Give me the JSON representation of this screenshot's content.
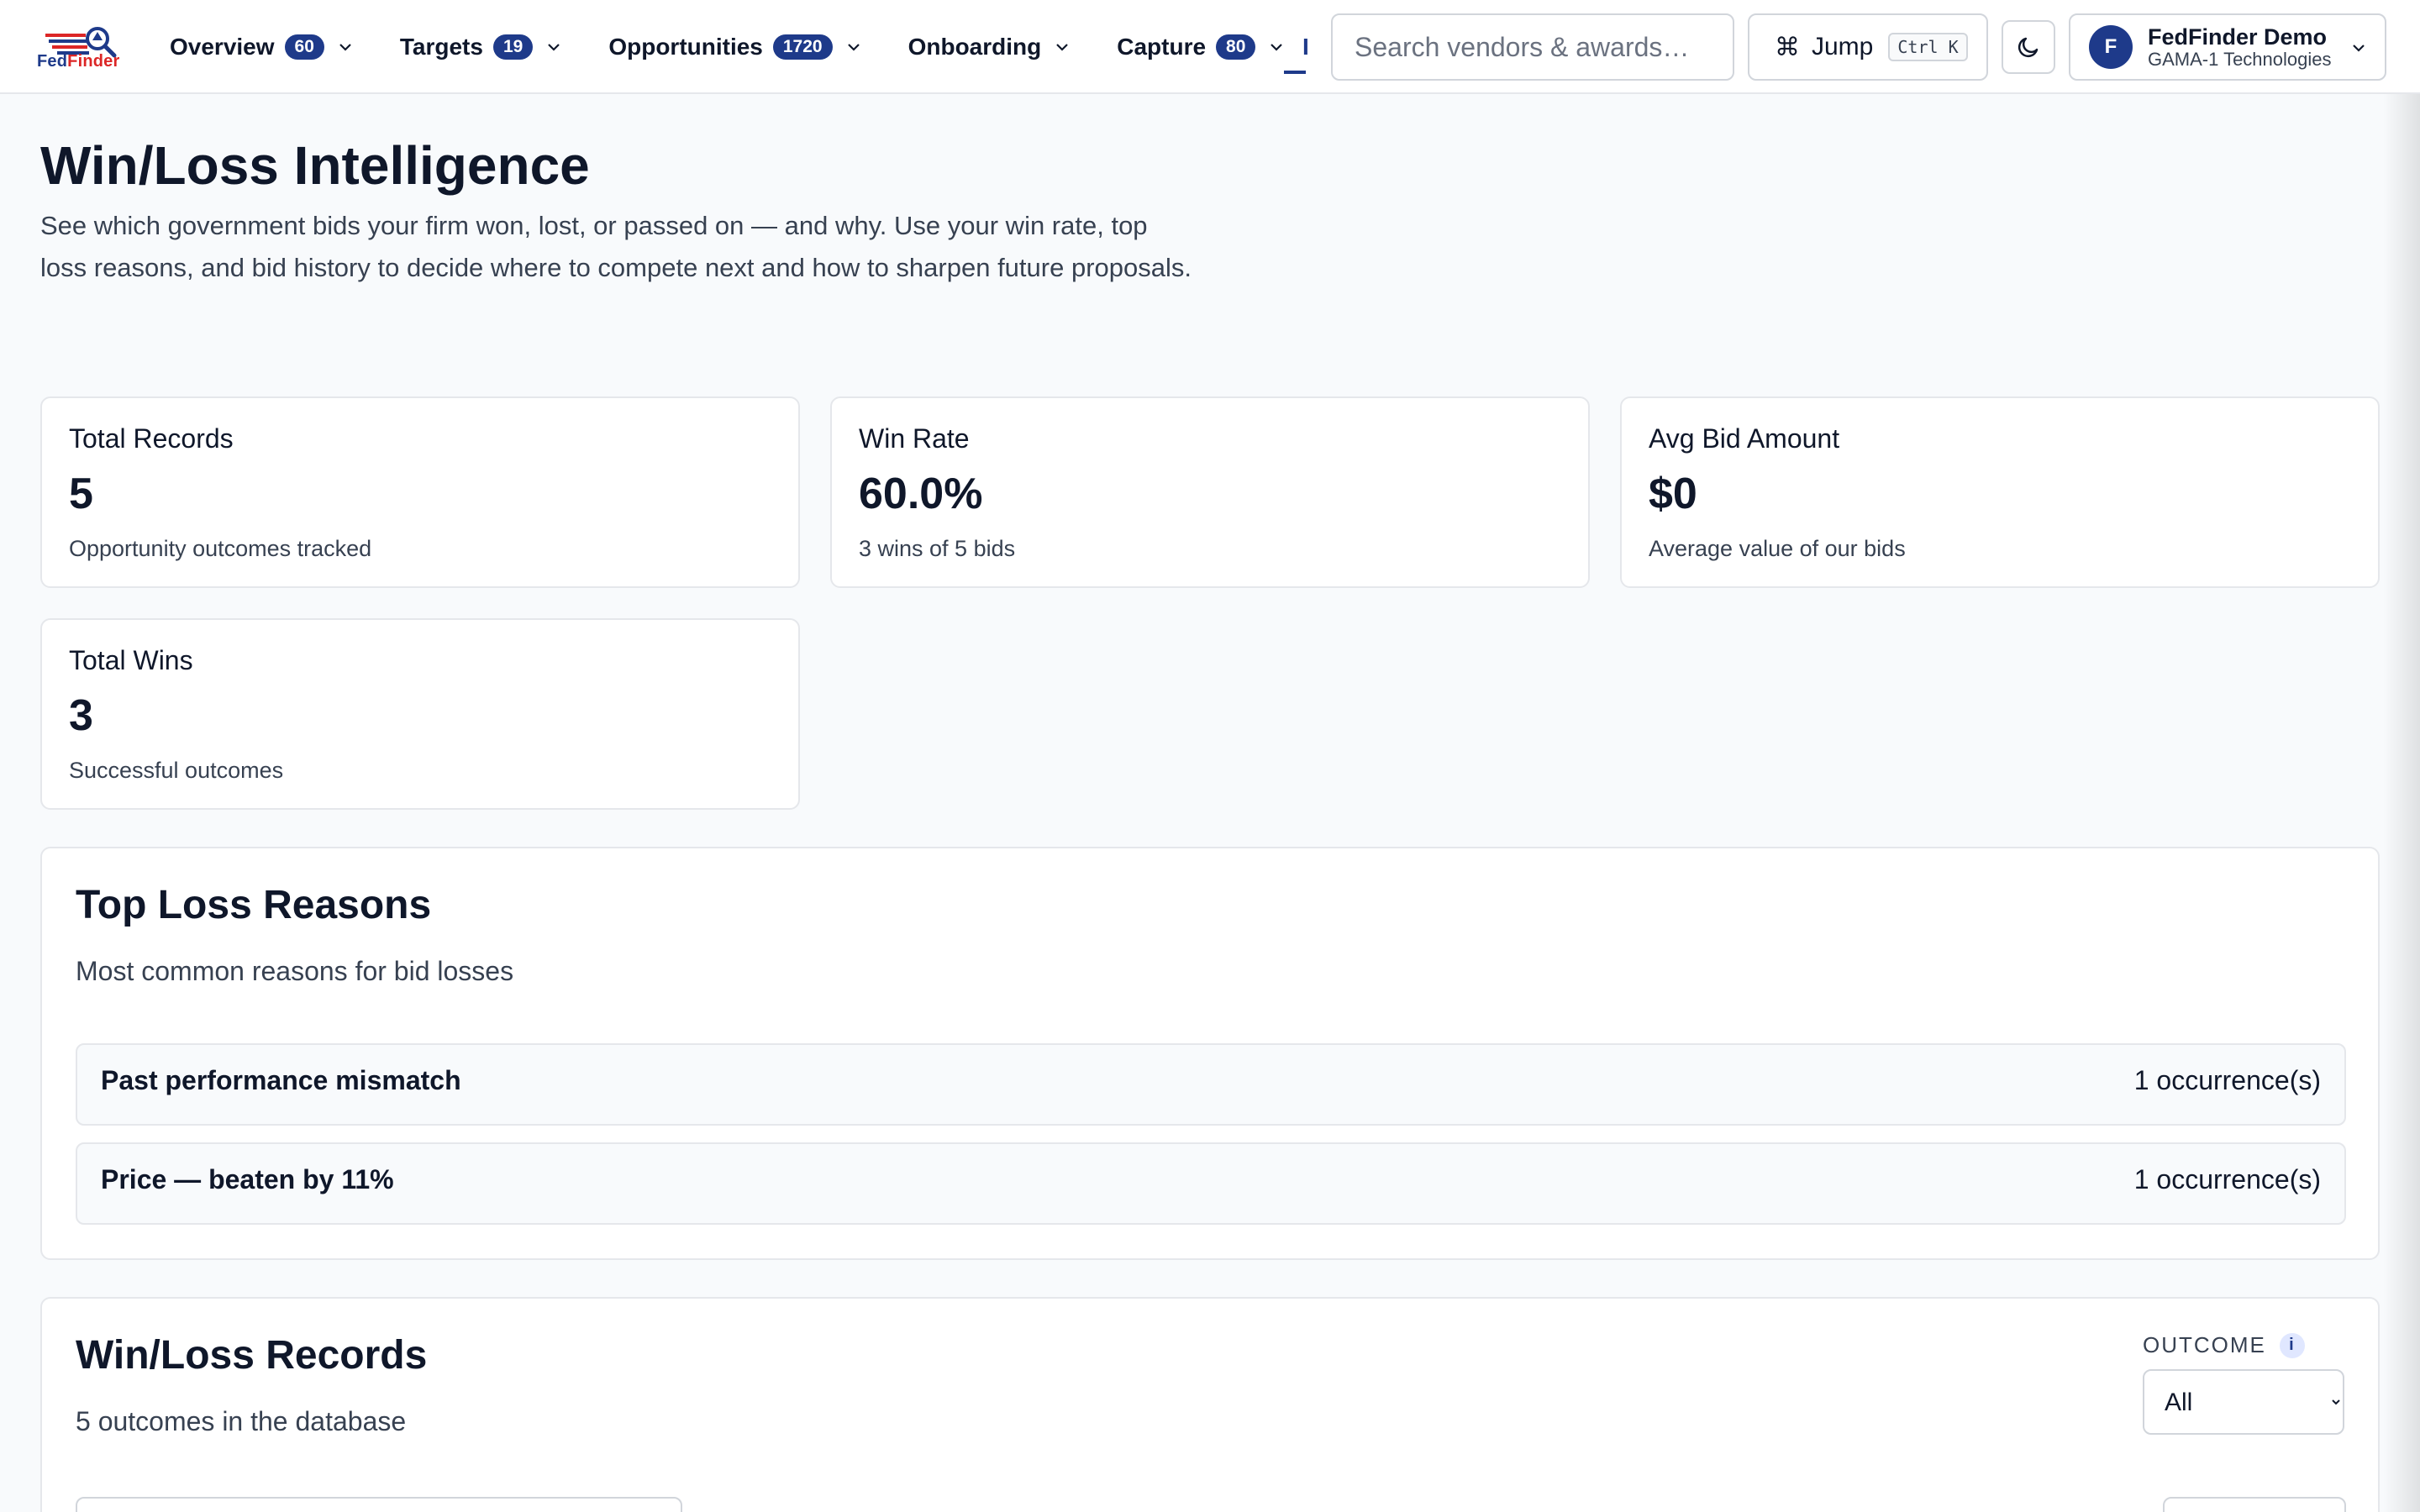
{
  "brand": {
    "logo_text_a": "Fed",
    "logo_text_b": "Finder"
  },
  "nav": {
    "items": [
      {
        "label": "Overview",
        "badge": "60"
      },
      {
        "label": "Targets",
        "badge": "19"
      },
      {
        "label": "Opportunities",
        "badge": "1720"
      },
      {
        "label": "Onboarding",
        "badge": ""
      },
      {
        "label": "Capture",
        "badge": "80"
      }
    ],
    "truncated_item": "I"
  },
  "search": {
    "placeholder": "Search vendors & awards…"
  },
  "jump": {
    "label": "Jump",
    "shortcut": "Ctrl K"
  },
  "user": {
    "initial": "F",
    "name": "FedFinder Demo",
    "org": "GAMA-1 Technologies"
  },
  "page": {
    "title": "Win/Loss Intelligence",
    "description": "See which government bids your firm won, lost, or passed on — and why. Use your win rate, top loss reasons, and bid history to decide where to compete next and how to sharpen future proposals."
  },
  "stats": [
    {
      "label": "Total Records",
      "value": "5",
      "sub": "Opportunity outcomes tracked"
    },
    {
      "label": "Win Rate",
      "value": "60.0%",
      "sub": "3 wins of 5 bids"
    },
    {
      "label": "Avg Bid Amount",
      "value": "$0",
      "sub": "Average value of our bids"
    },
    {
      "label": "Total Wins",
      "value": "3",
      "sub": "Successful outcomes"
    }
  ],
  "loss_reasons": {
    "title": "Top Loss Reasons",
    "subtitle": "Most common reasons for bid losses",
    "items": [
      {
        "reason": "Past performance mismatch",
        "count": "1 occurrence(s)"
      },
      {
        "reason": "Price — beaten by 11%",
        "count": "1 occurrence(s)"
      }
    ]
  },
  "records": {
    "title": "Win/Loss Records",
    "subtitle": "5 outcomes in the database",
    "filter_label": "OUTCOME",
    "filter_info": "i",
    "filter_options": [
      "All"
    ],
    "filter_value": "All"
  },
  "colors": {
    "brand": "#1e3a8a",
    "accent_red": "#dc2626",
    "text": "#0f172a",
    "muted": "#374151",
    "border": "#e5e7eb"
  }
}
